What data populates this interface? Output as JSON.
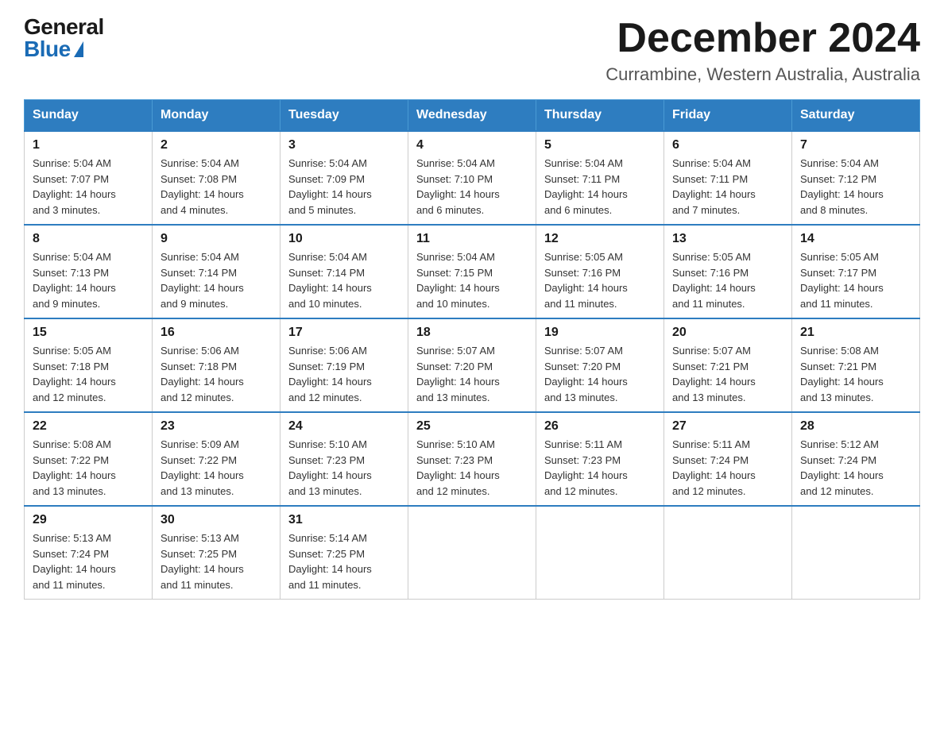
{
  "header": {
    "logo_general": "General",
    "logo_blue": "Blue",
    "month_title": "December 2024",
    "location": "Currambine, Western Australia, Australia"
  },
  "days_of_week": [
    "Sunday",
    "Monday",
    "Tuesday",
    "Wednesday",
    "Thursday",
    "Friday",
    "Saturday"
  ],
  "weeks": [
    [
      {
        "day": "1",
        "sunrise": "5:04 AM",
        "sunset": "7:07 PM",
        "daylight": "14 hours and 3 minutes."
      },
      {
        "day": "2",
        "sunrise": "5:04 AM",
        "sunset": "7:08 PM",
        "daylight": "14 hours and 4 minutes."
      },
      {
        "day": "3",
        "sunrise": "5:04 AM",
        "sunset": "7:09 PM",
        "daylight": "14 hours and 5 minutes."
      },
      {
        "day": "4",
        "sunrise": "5:04 AM",
        "sunset": "7:10 PM",
        "daylight": "14 hours and 6 minutes."
      },
      {
        "day": "5",
        "sunrise": "5:04 AM",
        "sunset": "7:11 PM",
        "daylight": "14 hours and 6 minutes."
      },
      {
        "day": "6",
        "sunrise": "5:04 AM",
        "sunset": "7:11 PM",
        "daylight": "14 hours and 7 minutes."
      },
      {
        "day": "7",
        "sunrise": "5:04 AM",
        "sunset": "7:12 PM",
        "daylight": "14 hours and 8 minutes."
      }
    ],
    [
      {
        "day": "8",
        "sunrise": "5:04 AM",
        "sunset": "7:13 PM",
        "daylight": "14 hours and 9 minutes."
      },
      {
        "day": "9",
        "sunrise": "5:04 AM",
        "sunset": "7:14 PM",
        "daylight": "14 hours and 9 minutes."
      },
      {
        "day": "10",
        "sunrise": "5:04 AM",
        "sunset": "7:14 PM",
        "daylight": "14 hours and 10 minutes."
      },
      {
        "day": "11",
        "sunrise": "5:04 AM",
        "sunset": "7:15 PM",
        "daylight": "14 hours and 10 minutes."
      },
      {
        "day": "12",
        "sunrise": "5:05 AM",
        "sunset": "7:16 PM",
        "daylight": "14 hours and 11 minutes."
      },
      {
        "day": "13",
        "sunrise": "5:05 AM",
        "sunset": "7:16 PM",
        "daylight": "14 hours and 11 minutes."
      },
      {
        "day": "14",
        "sunrise": "5:05 AM",
        "sunset": "7:17 PM",
        "daylight": "14 hours and 11 minutes."
      }
    ],
    [
      {
        "day": "15",
        "sunrise": "5:05 AM",
        "sunset": "7:18 PM",
        "daylight": "14 hours and 12 minutes."
      },
      {
        "day": "16",
        "sunrise": "5:06 AM",
        "sunset": "7:18 PM",
        "daylight": "14 hours and 12 minutes."
      },
      {
        "day": "17",
        "sunrise": "5:06 AM",
        "sunset": "7:19 PM",
        "daylight": "14 hours and 12 minutes."
      },
      {
        "day": "18",
        "sunrise": "5:07 AM",
        "sunset": "7:20 PM",
        "daylight": "14 hours and 13 minutes."
      },
      {
        "day": "19",
        "sunrise": "5:07 AM",
        "sunset": "7:20 PM",
        "daylight": "14 hours and 13 minutes."
      },
      {
        "day": "20",
        "sunrise": "5:07 AM",
        "sunset": "7:21 PM",
        "daylight": "14 hours and 13 minutes."
      },
      {
        "day": "21",
        "sunrise": "5:08 AM",
        "sunset": "7:21 PM",
        "daylight": "14 hours and 13 minutes."
      }
    ],
    [
      {
        "day": "22",
        "sunrise": "5:08 AM",
        "sunset": "7:22 PM",
        "daylight": "14 hours and 13 minutes."
      },
      {
        "day": "23",
        "sunrise": "5:09 AM",
        "sunset": "7:22 PM",
        "daylight": "14 hours and 13 minutes."
      },
      {
        "day": "24",
        "sunrise": "5:10 AM",
        "sunset": "7:23 PM",
        "daylight": "14 hours and 13 minutes."
      },
      {
        "day": "25",
        "sunrise": "5:10 AM",
        "sunset": "7:23 PM",
        "daylight": "14 hours and 12 minutes."
      },
      {
        "day": "26",
        "sunrise": "5:11 AM",
        "sunset": "7:23 PM",
        "daylight": "14 hours and 12 minutes."
      },
      {
        "day": "27",
        "sunrise": "5:11 AM",
        "sunset": "7:24 PM",
        "daylight": "14 hours and 12 minutes."
      },
      {
        "day": "28",
        "sunrise": "5:12 AM",
        "sunset": "7:24 PM",
        "daylight": "14 hours and 12 minutes."
      }
    ],
    [
      {
        "day": "29",
        "sunrise": "5:13 AM",
        "sunset": "7:24 PM",
        "daylight": "14 hours and 11 minutes."
      },
      {
        "day": "30",
        "sunrise": "5:13 AM",
        "sunset": "7:25 PM",
        "daylight": "14 hours and 11 minutes."
      },
      {
        "day": "31",
        "sunrise": "5:14 AM",
        "sunset": "7:25 PM",
        "daylight": "14 hours and 11 minutes."
      },
      null,
      null,
      null,
      null
    ]
  ],
  "labels": {
    "sunrise_prefix": "Sunrise: ",
    "sunset_prefix": "Sunset: ",
    "daylight_prefix": "Daylight: "
  }
}
